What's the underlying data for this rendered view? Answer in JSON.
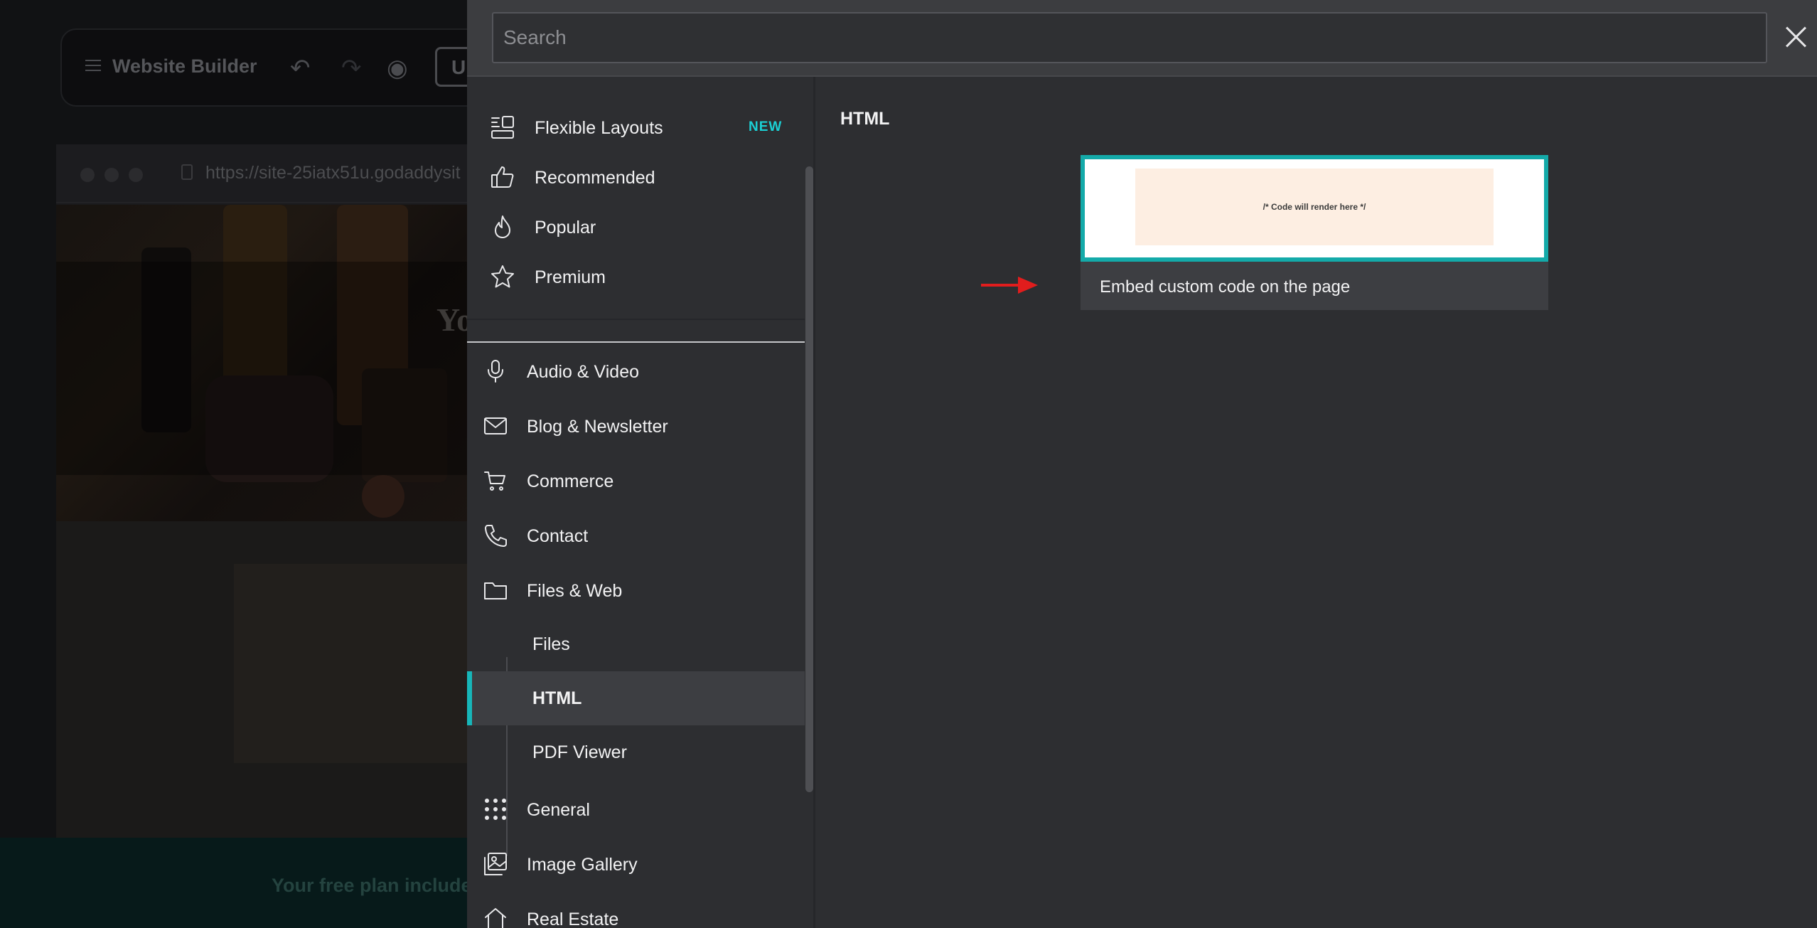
{
  "background": {
    "app_title": "Website Builder",
    "button_partial": "U",
    "url": "https://site-25iatx51u.godaddysit",
    "hero_text_partial": "Yo",
    "footer_text": "Your free plan include"
  },
  "search": {
    "placeholder": "Search",
    "value": ""
  },
  "categories_top": [
    {
      "label": "Flexible Layouts",
      "icon": "flexible-layouts-icon",
      "badge": "NEW"
    },
    {
      "label": "Recommended",
      "icon": "thumbs-up-icon"
    },
    {
      "label": "Popular",
      "icon": "flame-icon"
    },
    {
      "label": "Premium",
      "icon": "star-icon"
    }
  ],
  "categories": [
    {
      "label": "Audio & Video",
      "icon": "microphone-icon"
    },
    {
      "label": "Blog & Newsletter",
      "icon": "envelope-icon"
    },
    {
      "label": "Commerce",
      "icon": "cart-icon"
    },
    {
      "label": "Contact",
      "icon": "phone-icon"
    },
    {
      "label": "Files & Web",
      "icon": "folder-icon"
    }
  ],
  "subcategories": [
    {
      "label": "Files"
    },
    {
      "label": "HTML",
      "selected": true
    },
    {
      "label": "PDF Viewer"
    }
  ],
  "categories_bottom": [
    {
      "label": "General",
      "icon": "grid-icon"
    },
    {
      "label": "Image Gallery",
      "icon": "gallery-icon"
    },
    {
      "label": "Real Estate",
      "icon": "house-icon"
    }
  ],
  "content": {
    "section_title": "HTML",
    "widget": {
      "preview_text": "/* Code will render here */",
      "caption": "Embed custom code on the page"
    }
  },
  "colors": {
    "accent": "#17b6b9",
    "badge": "#1bd0d4",
    "annotation_arrow": "#e11d1d"
  }
}
